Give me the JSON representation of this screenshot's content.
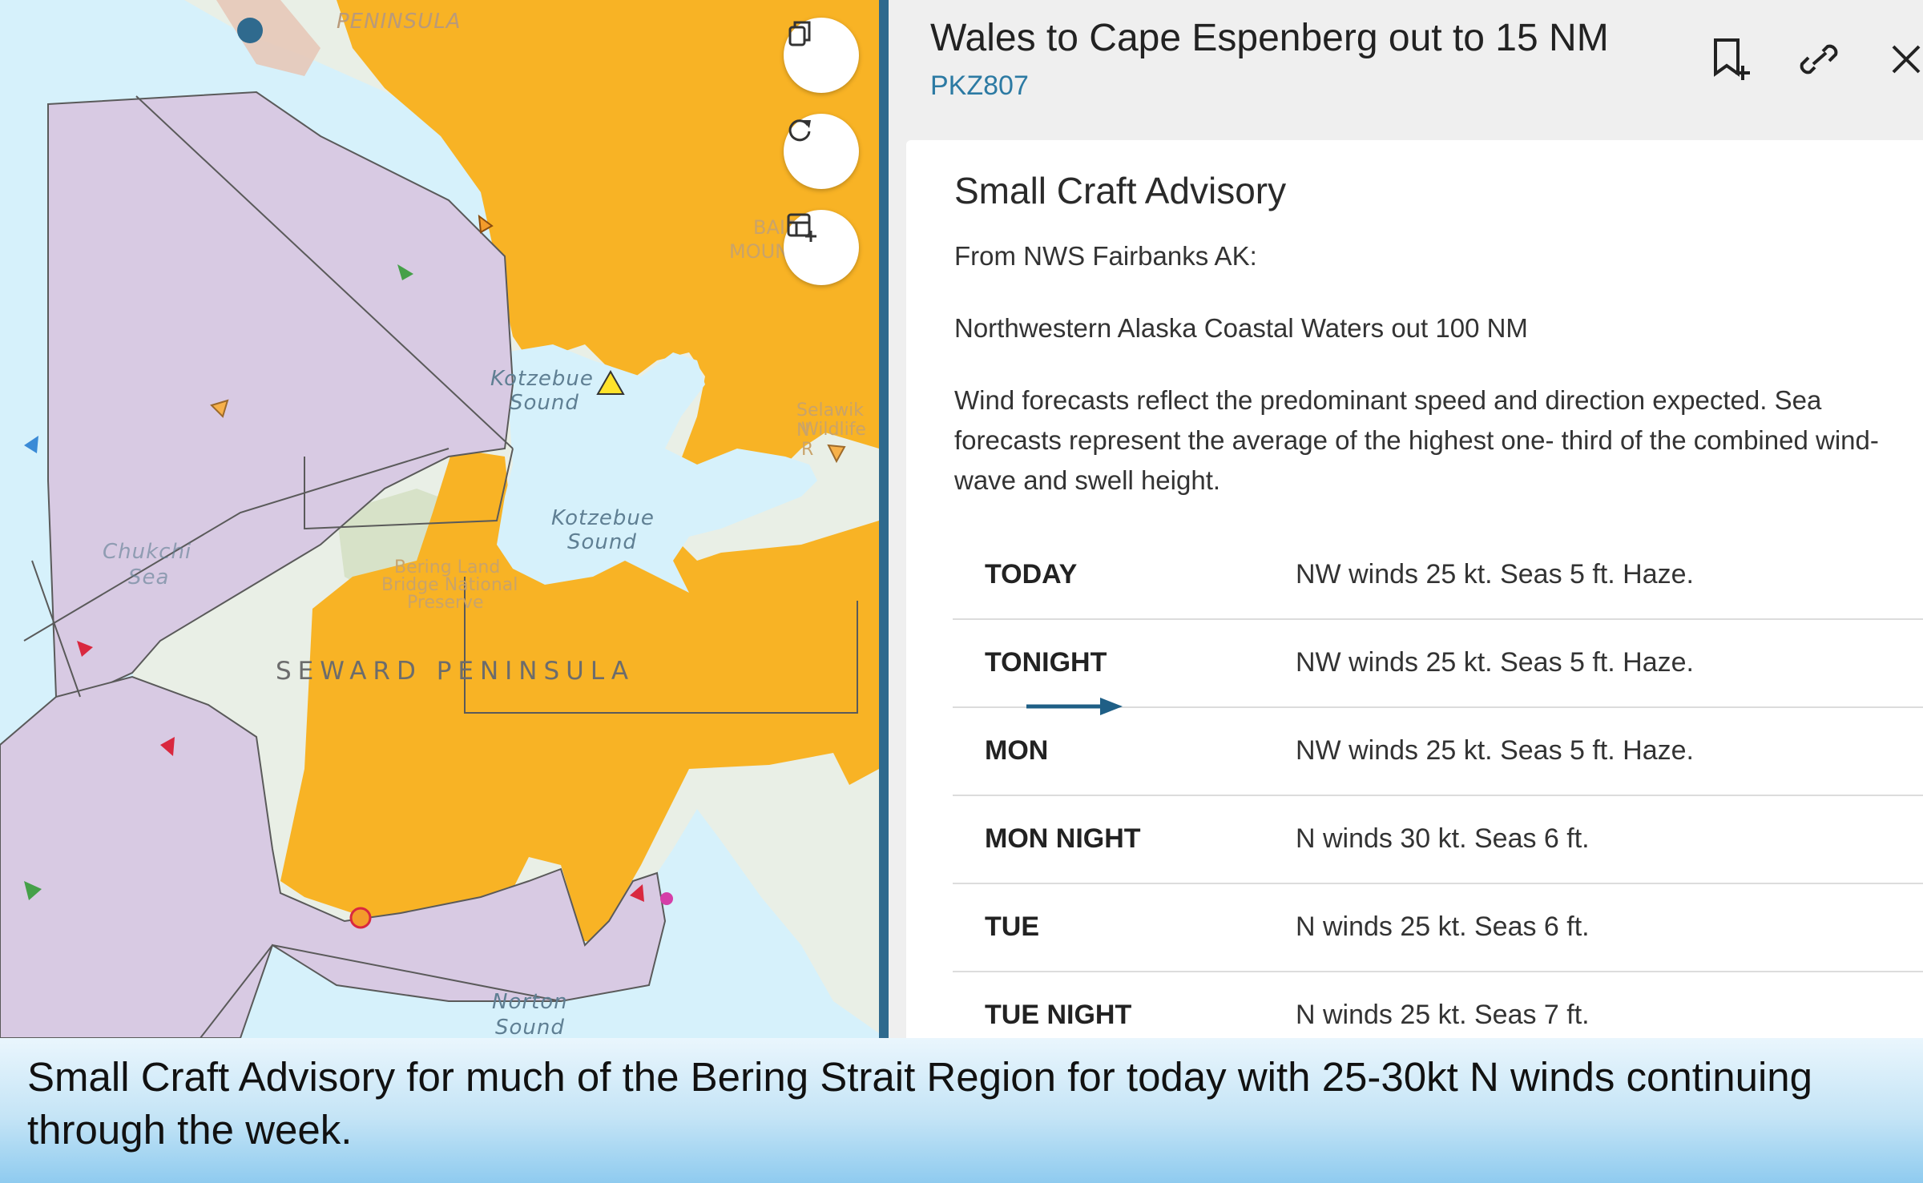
{
  "map": {
    "labels": {
      "peninsula_top": "PENINSULA",
      "kotzebue_sound_upper_1": "Kotzebue",
      "kotzebue_sound_upper_2": "Sound",
      "kotzebue_sound_1": "Kotzebue",
      "kotzebue_sound_2": "Sound",
      "chukchi_1": "Chukchi",
      "chukchi_2": "Sea",
      "seward_peninsula": "SEWARD PENINSULA",
      "norton_sound_1": "Norton",
      "norton_sound_2": "Sound",
      "bering_land_1": "Bering Land",
      "bering_land_2": "Bridge National",
      "bering_land_3": "Preserve",
      "baird_mountains_1": "BAIRD",
      "baird_mountains_2": "MOUNTAINS",
      "selawik_1": "Selawik N",
      "selawik_2": "Wildlife R"
    },
    "buttons": {
      "copy_icon": "copy-icon",
      "refresh_icon": "refresh-icon",
      "add_table_icon": "table-add-icon"
    },
    "colors": {
      "water": "#d6f1fb",
      "land": "#e9efe6",
      "advisory": "#f8b325",
      "zone": "#d8cae3",
      "zone_border": "#5a5a5a"
    }
  },
  "panel": {
    "title": "Wales to Cape Espenberg out to 15 NM",
    "zone_code": "PKZ807",
    "icons": [
      "bookmark-add-icon",
      "link-icon",
      "close-icon"
    ],
    "card": {
      "title": "Small Craft Advisory",
      "source": "From NWS Fairbanks AK:",
      "area": "Northwestern Alaska Coastal Waters out 100 NM",
      "description": "Wind forecasts reflect the predominant speed and direction expected. Sea forecasts represent the average of the highest one- third of the combined wind-wave and swell height.",
      "forecast": [
        {
          "period": "TODAY",
          "text": "NW winds 25 kt. Seas 5 ft. Haze."
        },
        {
          "period": "TONIGHT",
          "text": "NW winds 25 kt. Seas 5 ft. Haze."
        },
        {
          "period": "MON",
          "text": "NW winds 25 kt. Seas 5 ft. Haze."
        },
        {
          "period": "MON NIGHT",
          "text": "N winds 30 kt. Seas 6 ft."
        },
        {
          "period": "TUE",
          "text": "N winds 25 kt. Seas 6 ft."
        },
        {
          "period": "TUE NIGHT",
          "text": "N winds 25 kt. Seas 7 ft."
        }
      ]
    },
    "colors": {
      "accent": "#2c7aa3",
      "divider": "#2f6a8e"
    }
  },
  "caption": {
    "text": "Small Craft Advisory for much of the Bering Strait Region for today with 25-30kt N winds continuing through the week."
  }
}
